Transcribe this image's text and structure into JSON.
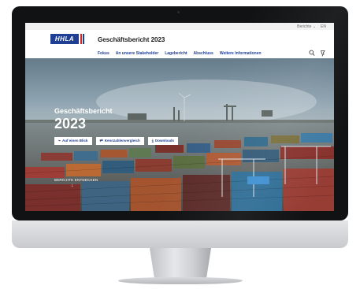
{
  "topbar": {
    "reports_label": "Berichte",
    "reports_chevron": "chevron-down-icon",
    "language_label": "EN"
  },
  "header": {
    "logo_text": "HHLA",
    "title": "Geschäftsbericht 2023"
  },
  "nav": {
    "items": [
      "Fokus",
      "An unsere Stakeholder",
      "Lagebericht",
      "Abschluss",
      "Weitere Informationen"
    ]
  },
  "hero": {
    "title": "Geschäftsbericht",
    "year": "2023",
    "buttons": [
      {
        "label": "Auf einen Blick",
        "icon": "chart-icon"
      },
      {
        "label": "Kennzahlenvergleich",
        "icon": "compare-icon"
      },
      {
        "label": "Downloads",
        "icon": "download-icon"
      }
    ],
    "discover_label": "BERICHTE ENTDECKEN",
    "discover_arrow": "↓"
  },
  "colors": {
    "brand_blue": "#1f3f95",
    "brand_red": "#d7222a",
    "bezel": "#111214"
  }
}
